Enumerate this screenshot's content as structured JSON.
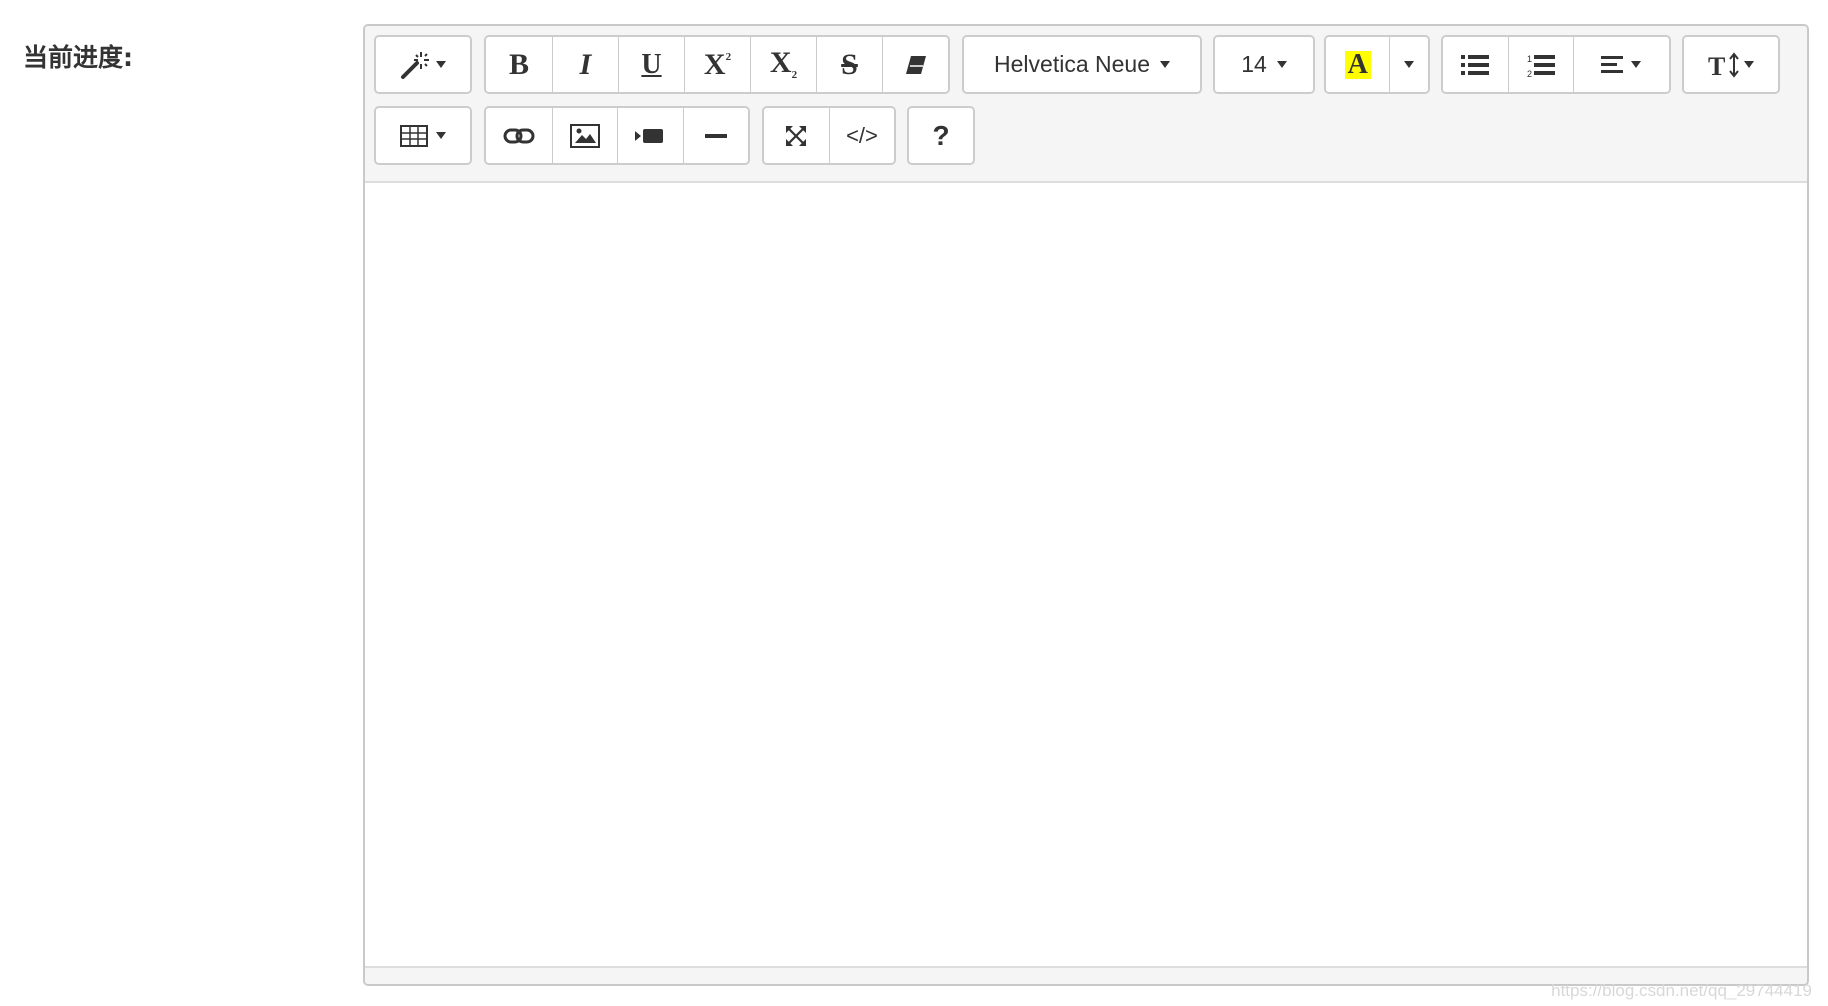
{
  "form": {
    "label": "当前进度:"
  },
  "editor": {
    "toolbar": {
      "font_name": "Helvetica Neue",
      "font_size": "14",
      "highlight_letter": "A",
      "help_label": "?",
      "code_view_label": "</>",
      "highlight_color": "#ffff00",
      "icons": {
        "style": "magic-wand-icon",
        "bold": "bold-icon",
        "italic": "italic-icon",
        "underline": "underline-icon",
        "superscript": "superscript-icon",
        "subscript": "subscript-icon",
        "strikethrough": "strikethrough-icon",
        "clear_format": "eraser-icon",
        "unordered_list": "unordered-list-icon",
        "ordered_list": "ordered-list-icon",
        "paragraph": "align-left-icon",
        "line_height": "text-height-icon",
        "table": "table-icon",
        "link": "link-icon",
        "picture": "picture-icon",
        "video": "video-icon",
        "hr": "horizontal-rule-icon",
        "fullscreen": "fullscreen-icon",
        "codeview": "code-icon",
        "help": "question-icon"
      }
    },
    "content": ""
  },
  "watermark": "https://blog.csdn.net/qq_29744419"
}
